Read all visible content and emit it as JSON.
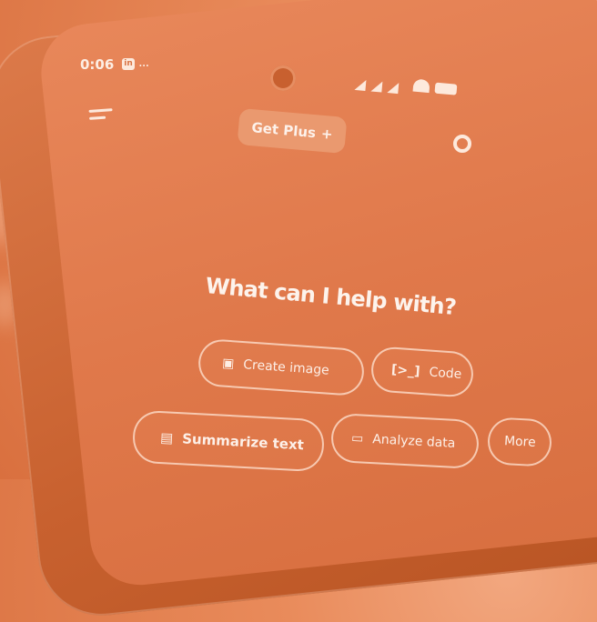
{
  "status_bar": {
    "time": "0:06",
    "app_badge": "in",
    "more": "..."
  },
  "header": {
    "get_plus_label": "Get Plus",
    "plus_icon": "+"
  },
  "main": {
    "headline": "What can I help with?"
  },
  "suggestions": [
    {
      "label": "Create image",
      "icon": "image-icon"
    },
    {
      "label": "Code",
      "icon": "code-icon"
    },
    {
      "label": "Summarize text",
      "icon": "document-icon"
    },
    {
      "label": "Analyze data",
      "icon": "bar-chart-icon"
    },
    {
      "label": "More",
      "icon": ""
    }
  ],
  "colors": {
    "tint": "#e0794b",
    "text": "#fdf3ec"
  }
}
